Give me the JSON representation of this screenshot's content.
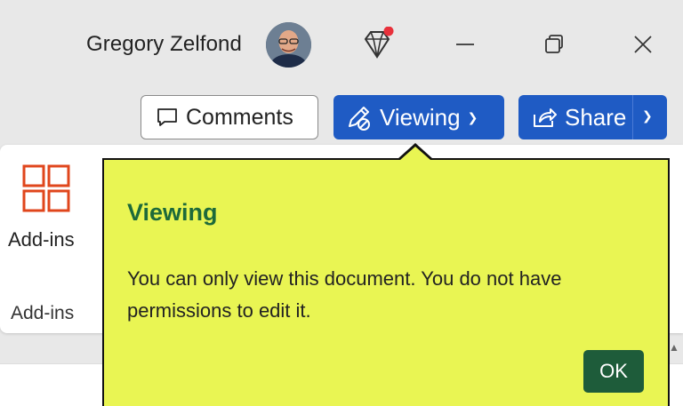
{
  "titlebar": {
    "user_name": "Gregory Zelfond",
    "notification_dot_color": "#e8313b"
  },
  "toolbar": {
    "comments_label": "Comments",
    "viewing_label": "Viewing",
    "share_label": "Share",
    "accent_color": "#1f5bc4"
  },
  "ribbon": {
    "addins_button_label": "Add-ins",
    "addins_group_label": "Add-ins",
    "addins_icon_color": "#e0461c"
  },
  "callout": {
    "title": "Viewing",
    "body": "You can only view this document. You do not have permissions to edit it.",
    "ok_label": "OK",
    "background_color": "#e9f553",
    "title_color": "#1d6a3a"
  }
}
